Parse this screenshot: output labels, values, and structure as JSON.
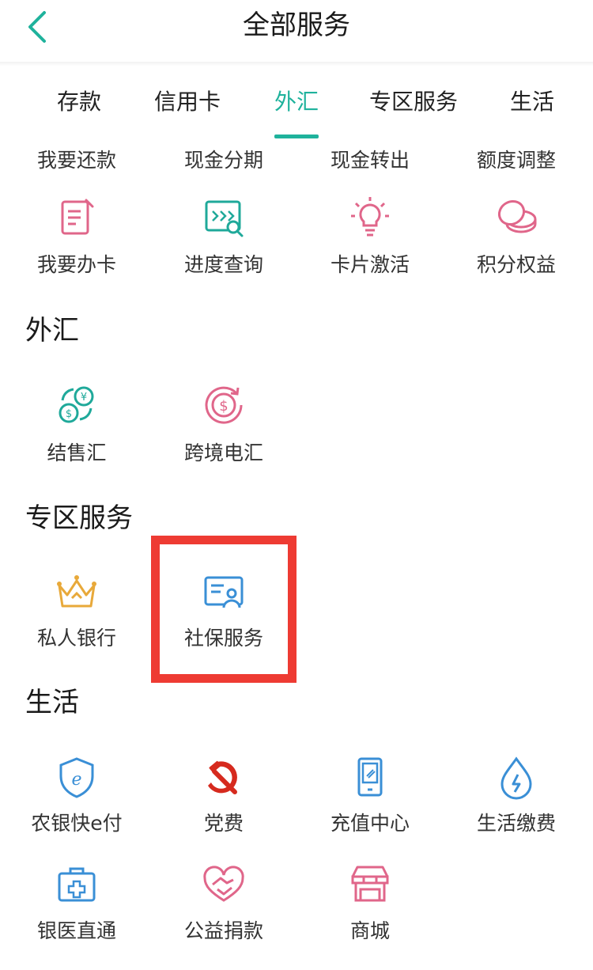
{
  "header": {
    "title": "全部服务",
    "back_icon": "chevron-left-icon"
  },
  "tabs": [
    {
      "label": "存款"
    },
    {
      "label": "信用卡"
    },
    {
      "label": "外汇",
      "active": true
    },
    {
      "label": "专区服务"
    },
    {
      "label": "生活"
    }
  ],
  "credit_card": {
    "top_row": [
      "我要还款",
      "现金分期",
      "现金转出",
      "额度调整"
    ],
    "items": [
      {
        "label": "我要办卡",
        "icon": "apply-card-icon"
      },
      {
        "label": "进度查询",
        "icon": "progress-query-icon"
      },
      {
        "label": "卡片激活",
        "icon": "lightbulb-icon"
      },
      {
        "label": "积分权益",
        "icon": "coins-icon"
      }
    ]
  },
  "forex": {
    "title": "外汇",
    "items": [
      {
        "label": "结售汇",
        "icon": "currency-exchange-icon"
      },
      {
        "label": "跨境电汇",
        "icon": "dollar-transfer-icon"
      }
    ]
  },
  "special": {
    "title": "专区服务",
    "items": [
      {
        "label": "私人银行",
        "icon": "crown-icon"
      },
      {
        "label": "社保服务",
        "icon": "id-card-icon"
      }
    ]
  },
  "life": {
    "title": "生活",
    "items": [
      {
        "label": "农银快e付",
        "icon": "e-shield-icon"
      },
      {
        "label": "党费",
        "icon": "hammer-sickle-icon"
      },
      {
        "label": "充值中心",
        "icon": "phone-icon"
      },
      {
        "label": "生活缴费",
        "icon": "water-drop-icon"
      },
      {
        "label": "银医直通",
        "icon": "medical-kit-icon"
      },
      {
        "label": "公益捐款",
        "icon": "heart-hand-icon"
      },
      {
        "label": "商城",
        "icon": "shop-icon"
      }
    ]
  },
  "colors": {
    "accent": "#1fb29c",
    "pink": "#e0668a",
    "teal": "#1fa99a",
    "blue": "#3a8fd6",
    "gold": "#e8a93a",
    "red": "#d62a1e",
    "highlight": "#ee3b33"
  }
}
